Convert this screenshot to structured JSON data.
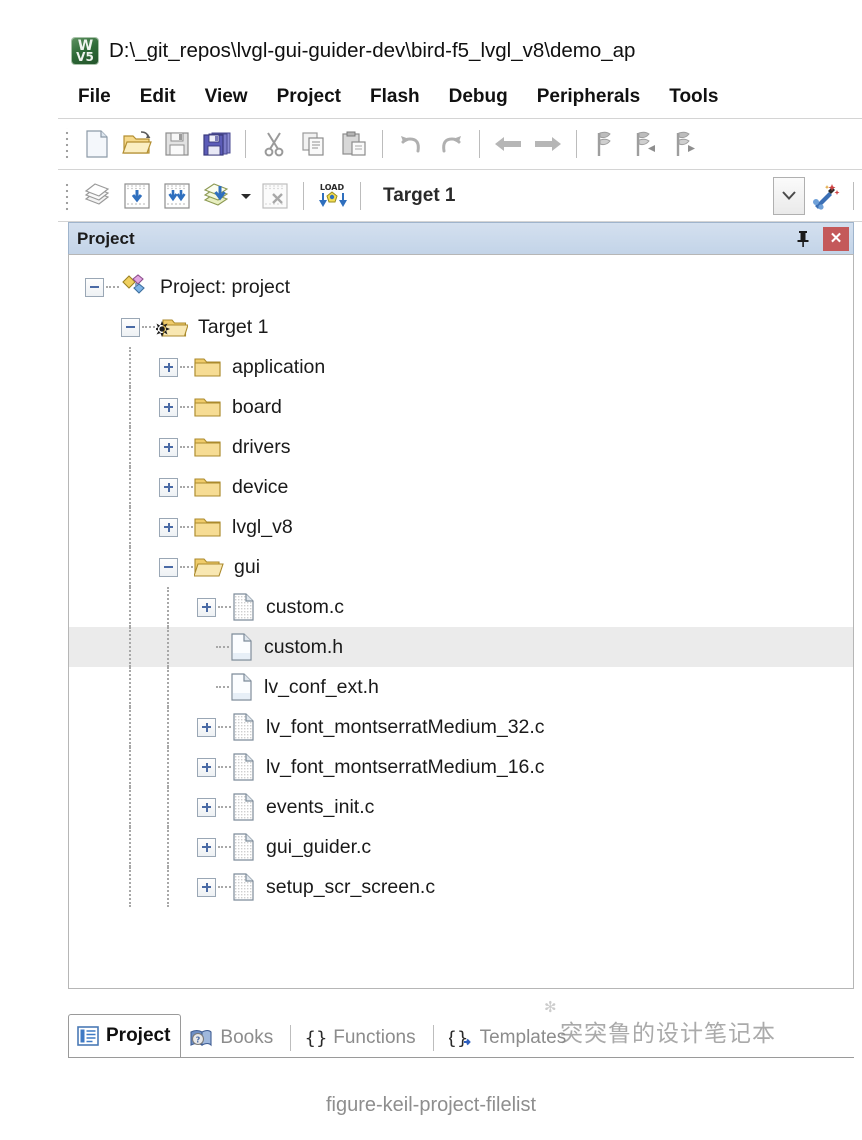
{
  "window": {
    "title": "D:\\_git_repos\\lvgl-gui-guider-dev\\bird-f5_lvgl_v8\\demo_ap",
    "app_icon": "keil-uvision5-icon",
    "logo_top": "W",
    "logo_bottom": "V5"
  },
  "menubar": {
    "items": [
      {
        "label": "File"
      },
      {
        "label": "Edit"
      },
      {
        "label": "View"
      },
      {
        "label": "Project"
      },
      {
        "label": "Flash"
      },
      {
        "label": "Debug"
      },
      {
        "label": "Peripherals"
      },
      {
        "label": "Tools"
      }
    ]
  },
  "toolbar_main": {
    "buttons": [
      {
        "icon": "new-file-icon",
        "label": "New"
      },
      {
        "icon": "open-folder-icon",
        "label": "Open"
      },
      {
        "icon": "save-icon",
        "label": "Save"
      },
      {
        "icon": "save-all-icon",
        "label": "Save All"
      },
      {
        "icon": "cut-icon",
        "label": "Cut"
      },
      {
        "icon": "copy-icon",
        "label": "Copy"
      },
      {
        "icon": "paste-icon",
        "label": "Paste"
      },
      {
        "icon": "undo-icon",
        "label": "Undo"
      },
      {
        "icon": "redo-icon",
        "label": "Redo"
      },
      {
        "icon": "back-arrow-icon",
        "label": "Navigate Backwards"
      },
      {
        "icon": "forward-arrow-icon",
        "label": "Navigate Forwards"
      },
      {
        "icon": "bookmark-toggle-icon",
        "label": "Insert/Remove Bookmark"
      },
      {
        "icon": "bookmark-prev-icon",
        "label": "Previous Bookmark"
      },
      {
        "icon": "bookmark-next-icon",
        "label": "Next Bookmark"
      }
    ]
  },
  "toolbar_build": {
    "buttons": [
      {
        "icon": "translate-icon",
        "label": "Translate"
      },
      {
        "icon": "build-icon",
        "label": "Build"
      },
      {
        "icon": "rebuild-icon",
        "label": "Rebuild"
      },
      {
        "icon": "batch-build-icon",
        "label": "Batch Build"
      },
      {
        "icon": "batch-build-dropdown-icon",
        "label": "Batch Build Options"
      },
      {
        "icon": "stop-build-icon",
        "label": "Stop Build"
      },
      {
        "icon": "download-icon",
        "label": "Download"
      }
    ],
    "target_value": "Target 1",
    "target_dropdown_icon": "chevron-down-icon",
    "manage_icon": "manage-project-items-icon"
  },
  "project_panel": {
    "title": "Project",
    "pin_icon": "pin-icon",
    "close_icon": "close-icon",
    "close_glyph": "✕"
  },
  "tree": {
    "nodes": [
      {
        "label": "Project: project",
        "icon": "project-icon",
        "depth": 0,
        "state": "expanded",
        "selected": false
      },
      {
        "label": "Target 1",
        "icon": "target-icon",
        "depth": 1,
        "state": "expanded",
        "selected": false
      },
      {
        "label": "application",
        "icon": "folder-icon",
        "depth": 2,
        "state": "collapsed",
        "selected": false
      },
      {
        "label": "board",
        "icon": "folder-icon",
        "depth": 2,
        "state": "collapsed",
        "selected": false
      },
      {
        "label": "drivers",
        "icon": "folder-icon",
        "depth": 2,
        "state": "collapsed",
        "selected": false
      },
      {
        "label": "device",
        "icon": "folder-icon",
        "depth": 2,
        "state": "collapsed",
        "selected": false
      },
      {
        "label": "lvgl_v8",
        "icon": "folder-icon",
        "depth": 2,
        "state": "collapsed",
        "selected": false
      },
      {
        "label": "gui",
        "icon": "folder-open-icon",
        "depth": 2,
        "state": "expanded",
        "selected": false
      },
      {
        "label": "custom.c",
        "icon": "c-file-icon",
        "depth": 3,
        "state": "collapsed",
        "selected": false
      },
      {
        "label": "custom.h",
        "icon": "h-file-icon",
        "depth": 3,
        "state": "leaf",
        "selected": true
      },
      {
        "label": "lv_conf_ext.h",
        "icon": "h-file-icon",
        "depth": 3,
        "state": "leaf",
        "selected": false
      },
      {
        "label": "lv_font_montserratMedium_32.c",
        "icon": "c-file-icon",
        "depth": 3,
        "state": "collapsed",
        "selected": false
      },
      {
        "label": "lv_font_montserratMedium_16.c",
        "icon": "c-file-icon",
        "depth": 3,
        "state": "collapsed",
        "selected": false
      },
      {
        "label": "events_init.c",
        "icon": "c-file-icon",
        "depth": 3,
        "state": "collapsed",
        "selected": false
      },
      {
        "label": "gui_guider.c",
        "icon": "c-file-icon",
        "depth": 3,
        "state": "collapsed",
        "selected": false
      },
      {
        "label": "setup_scr_screen.c",
        "icon": "c-file-icon",
        "depth": 3,
        "state": "collapsed",
        "selected": false
      }
    ]
  },
  "bottom_tabs": {
    "items": [
      {
        "label": "Project",
        "icon": "project-tab-icon",
        "active": true
      },
      {
        "label": "Books",
        "icon": "books-tab-icon",
        "active": false
      },
      {
        "label": "Functions",
        "icon": "functions-tab-icon",
        "active": false
      },
      {
        "label": "Templates",
        "icon": "templates-tab-icon",
        "active": false
      }
    ]
  },
  "watermark": {
    "text": "突突鲁的设计笔记本",
    "mark": "✻"
  },
  "caption": {
    "text": "figure-keil-project-filelist"
  },
  "colors": {
    "dock_header_from": "#d4e0ef",
    "dock_header_to": "#c3d4e8",
    "close_button": "#c4595a",
    "selection": "#ebebeb",
    "folder": "#f2cc6b",
    "caption_text": "#8e8e8e"
  }
}
